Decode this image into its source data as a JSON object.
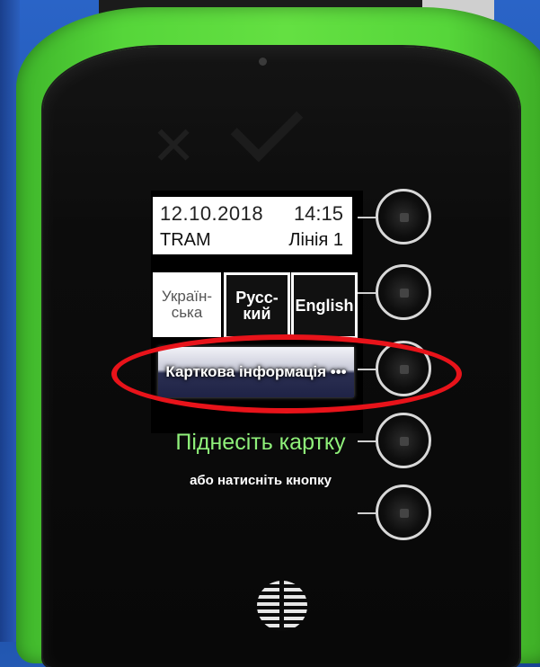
{
  "screen": {
    "info": {
      "date": "12.10.2018",
      "time": "14:15",
      "mode": "TRAM",
      "line": "Лінія 1"
    },
    "languages": [
      {
        "label_line1": "Україн-",
        "label_line2": "ська"
      },
      {
        "label_line1": "Русс-",
        "label_line2": "кий"
      },
      {
        "label_line1": "English",
        "label_line2": ""
      }
    ],
    "card_info_button": "Карткова інформація •••",
    "present_card": "Піднесіть картку",
    "or_press_button": "або натисніть кнопку"
  },
  "colors": {
    "device_body": "#56d63a",
    "present_text": "#8ff07a",
    "highlight": "#e8131a"
  },
  "icons": [
    "speaker-grille-icon",
    "camera-dot-icon",
    "cancel-x-icon",
    "confirm-check-icon"
  ]
}
